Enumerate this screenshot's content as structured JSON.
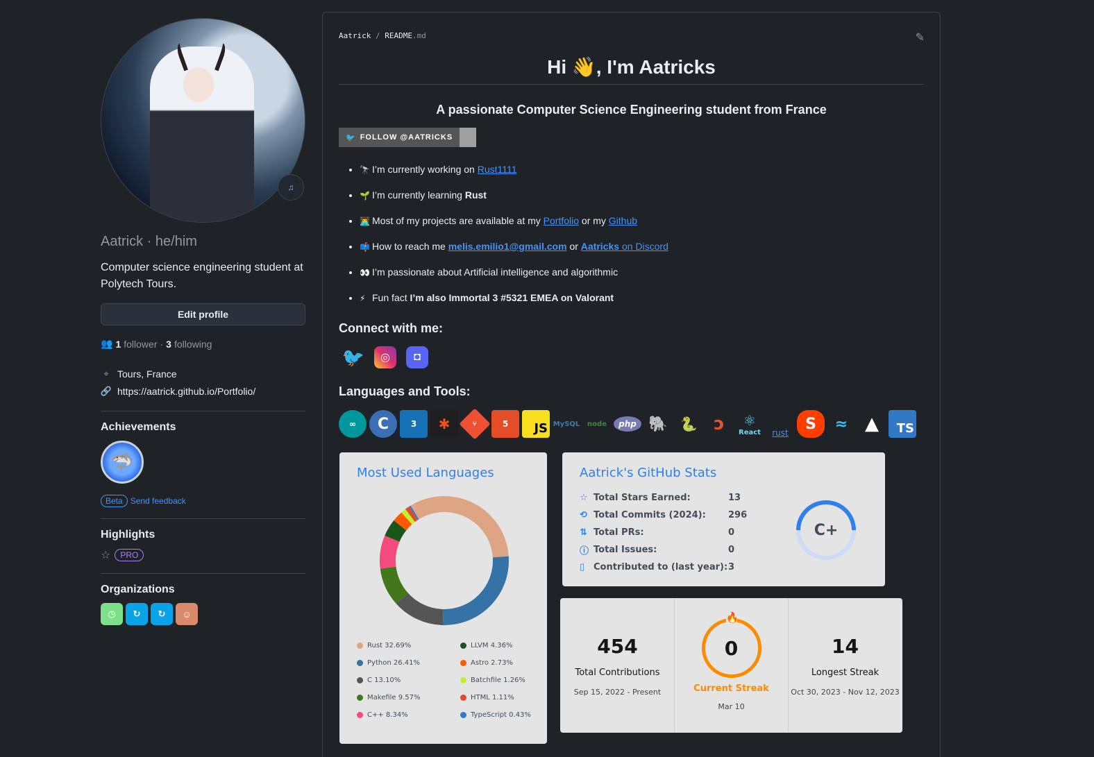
{
  "profile": {
    "name": "Aatrick",
    "pronouns": "he/him",
    "name_line": "Aatrick · he/him",
    "bio": "Computer science engineering student at Polytech Tours.",
    "edit_button": "Edit profile",
    "followers_count": "1",
    "followers_label": "follower",
    "following_count": "3",
    "following_label": "following",
    "location": "Tours, France",
    "website": "https://aatrick.github.io/Portfolio/"
  },
  "achievements": {
    "title": "Achievements",
    "beta": "Beta",
    "feedback": "Send feedback"
  },
  "highlights": {
    "title": "Highlights",
    "pro": "PRO"
  },
  "organizations": {
    "title": "Organizations"
  },
  "readme": {
    "breadcrumb_user": "Aatrick",
    "breadcrumb_sep": "/",
    "breadcrumb_file": "README",
    "breadcrumb_ext": ".md",
    "heading": "Hi 👋, I'm Aatricks",
    "subtitle": "A passionate Computer Science Engineering student from France",
    "twitter_badge": "FOLLOW @AATRICKS",
    "bullets": {
      "b1_text": "I’m currently working on",
      "b1_link": "Rust1111",
      "b2_text": "I’m currently learning",
      "b2_bold": "Rust",
      "b3_text": "Most of my projects are available at my",
      "b3_link1": "Portfolio",
      "b3_mid": "or my",
      "b3_link2": "Github",
      "b4_text": "How to reach me",
      "b4_link1": "melis.emilio1@gmail.com",
      "b4_mid": "or",
      "b4_link2a": "Aatricks",
      "b4_link2b": "on Discord",
      "b5_text": "I’m passionate about Artificial intelligence and algorithmic",
      "b6_text": "Fun fact",
      "b6_bold": "I’m also Immortal 3 #5321 EMEA on Valorant"
    },
    "connect_title": "Connect with me:",
    "tools_title": "Languages and Tools:",
    "tool_labels": {
      "react": "React",
      "rust": "rust",
      "js": "JS",
      "ts": "TS",
      "php": "php",
      "html": "5",
      "css": "3"
    }
  },
  "languages_card": {
    "title": "Most Used Languages",
    "items": [
      {
        "name": "Rust 32.69%",
        "color": "#dea584"
      },
      {
        "name": "LLVM 4.36%",
        "color": "#185619"
      },
      {
        "name": "Python 26.41%",
        "color": "#3572A5"
      },
      {
        "name": "Astro 2.73%",
        "color": "#ff5a03"
      },
      {
        "name": "C 13.10%",
        "color": "#555555"
      },
      {
        "name": "Batchfile 1.26%",
        "color": "#C1F12E"
      },
      {
        "name": "Makefile 9.57%",
        "color": "#427819"
      },
      {
        "name": "HTML 1.11%",
        "color": "#e34c26"
      },
      {
        "name": "C++ 8.34%",
        "color": "#f34b7d"
      },
      {
        "name": "TypeScript 0.43%",
        "color": "#3178c6"
      }
    ]
  },
  "chart_data": {
    "type": "pie",
    "title": "Most Used Languages",
    "categories": [
      "Rust",
      "Python",
      "C",
      "Makefile",
      "C++",
      "LLVM",
      "Astro",
      "Batchfile",
      "HTML",
      "TypeScript"
    ],
    "values": [
      32.69,
      26.41,
      13.1,
      9.57,
      8.34,
      4.36,
      2.73,
      1.26,
      1.11,
      0.43
    ],
    "colors": [
      "#dea584",
      "#3572A5",
      "#555555",
      "#427819",
      "#f34b7d",
      "#185619",
      "#ff5a03",
      "#C1F12E",
      "#e34c26",
      "#3178c6"
    ]
  },
  "stats_card": {
    "title": "Aatrick's GitHub Stats",
    "rows": [
      {
        "label": "Total Stars Earned:",
        "value": "13",
        "icon": "star-icon"
      },
      {
        "label": "Total Commits (2024):",
        "value": "296",
        "icon": "history-icon"
      },
      {
        "label": "Total PRs:",
        "value": "0",
        "icon": "pull-request-icon"
      },
      {
        "label": "Total Issues:",
        "value": "0",
        "icon": "issue-icon"
      },
      {
        "label": "Contributed to (last year):",
        "value": "3",
        "icon": "repo-icon"
      }
    ],
    "rank": "C+"
  },
  "streak_card": {
    "total": "454",
    "total_label": "Total Contributions",
    "total_range": "Sep 15, 2022 - Present",
    "current": "0",
    "current_label": "Current Streak",
    "current_date": "Mar 10",
    "longest": "14",
    "longest_label": "Longest Streak",
    "longest_range": "Oct 30, 2023 - Nov 12, 2023"
  }
}
